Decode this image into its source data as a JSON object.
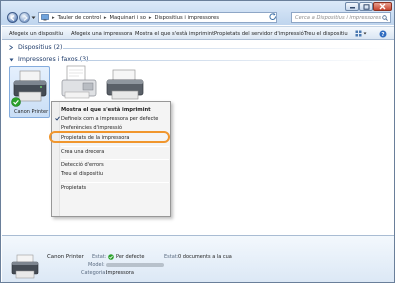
{
  "window": {
    "minimize_icon": "minimize-icon",
    "maximize_icon": "maximize-icon",
    "close_icon": "close-icon"
  },
  "address": {
    "segments": [
      "Tauler de control",
      "Maquinari i so",
      "Dispositius i impressores"
    ],
    "separator": "▸"
  },
  "search": {
    "placeholder": "Cerca a Dispositius i impressores"
  },
  "toolbar": {
    "add_device": "Afegeix un dispositiu",
    "add_printer": "Afegeix una impressora",
    "see_printing": "Mostra el que s'està imprimint",
    "server_props": "Propietats del servidor d'impressió",
    "remove_device": "Treu el dispositiu"
  },
  "groups": {
    "devices": "Dispositius (2)",
    "printers": "Impressores i faxos (3)"
  },
  "printers": {
    "selected_label": "Canon Printer"
  },
  "context_menu": {
    "items": [
      "Mostra el que s'està imprimint",
      "Defineix com a impressora per defecte",
      "Preferències d'impressió",
      "Propietats de la impressora",
      "Crea una drecera",
      "Detecció d'errors",
      "Treu el dispositiu",
      "Propietats"
    ]
  },
  "details": {
    "name": "Canon Printer",
    "state_label": "Estat:",
    "state_value": "Per defecte",
    "docs_label": "Estat:",
    "docs_value": "0 documents a la cua",
    "model_label": "Model:",
    "category_label": "Categoria:",
    "category_value": "Impressora"
  },
  "colors": {
    "accent": "#f0962d",
    "default_check": "#2aa12a"
  }
}
